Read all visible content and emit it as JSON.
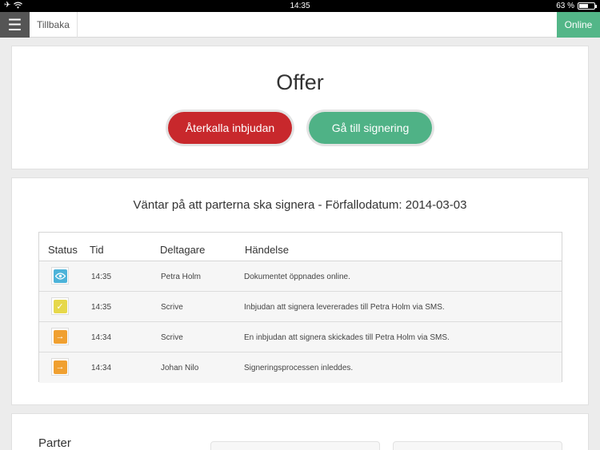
{
  "statusbar": {
    "time": "14:35",
    "battery": "63 %",
    "battery_level": 0.63
  },
  "topbar": {
    "back_label": "Tillbaka",
    "online_label": "Online"
  },
  "document": {
    "title": "Offer",
    "withdraw_label": "Återkalla inbjudan",
    "sign_label": "Gå till signering"
  },
  "history": {
    "title": "Väntar på att parterna ska signera - Förfallodatum: 2014-03-03",
    "columns": [
      "Status",
      "Tid",
      "Deltagare",
      "Händelse"
    ],
    "rows": [
      {
        "status": "eye-icon",
        "color": "#4cb3d9",
        "time": "14:35",
        "participant": "Petra Holm",
        "event": "Dokumentet öppnades online."
      },
      {
        "status": "checkmark-icon",
        "color": "#e6d84a",
        "time": "14:35",
        "participant": "Scrive",
        "event": "Inbjudan  att signera levererades till Petra Holm via SMS."
      },
      {
        "status": "arrow-right-icon",
        "color": "#f0a030",
        "time": "14:34",
        "participant": "Scrive",
        "event": "En inbjudan att signera skickades till Petra Holm via SMS."
      },
      {
        "status": "arrow-right-icon",
        "color": "#f0a030",
        "time": "14:34",
        "participant": "Johan Nilo",
        "event": "Signeringsprocessen inleddes."
      }
    ]
  },
  "parties": {
    "title": "Parter"
  },
  "colors": {
    "online": "#53b688",
    "withdraw": "#c8282c",
    "sign": "#4fb286"
  }
}
